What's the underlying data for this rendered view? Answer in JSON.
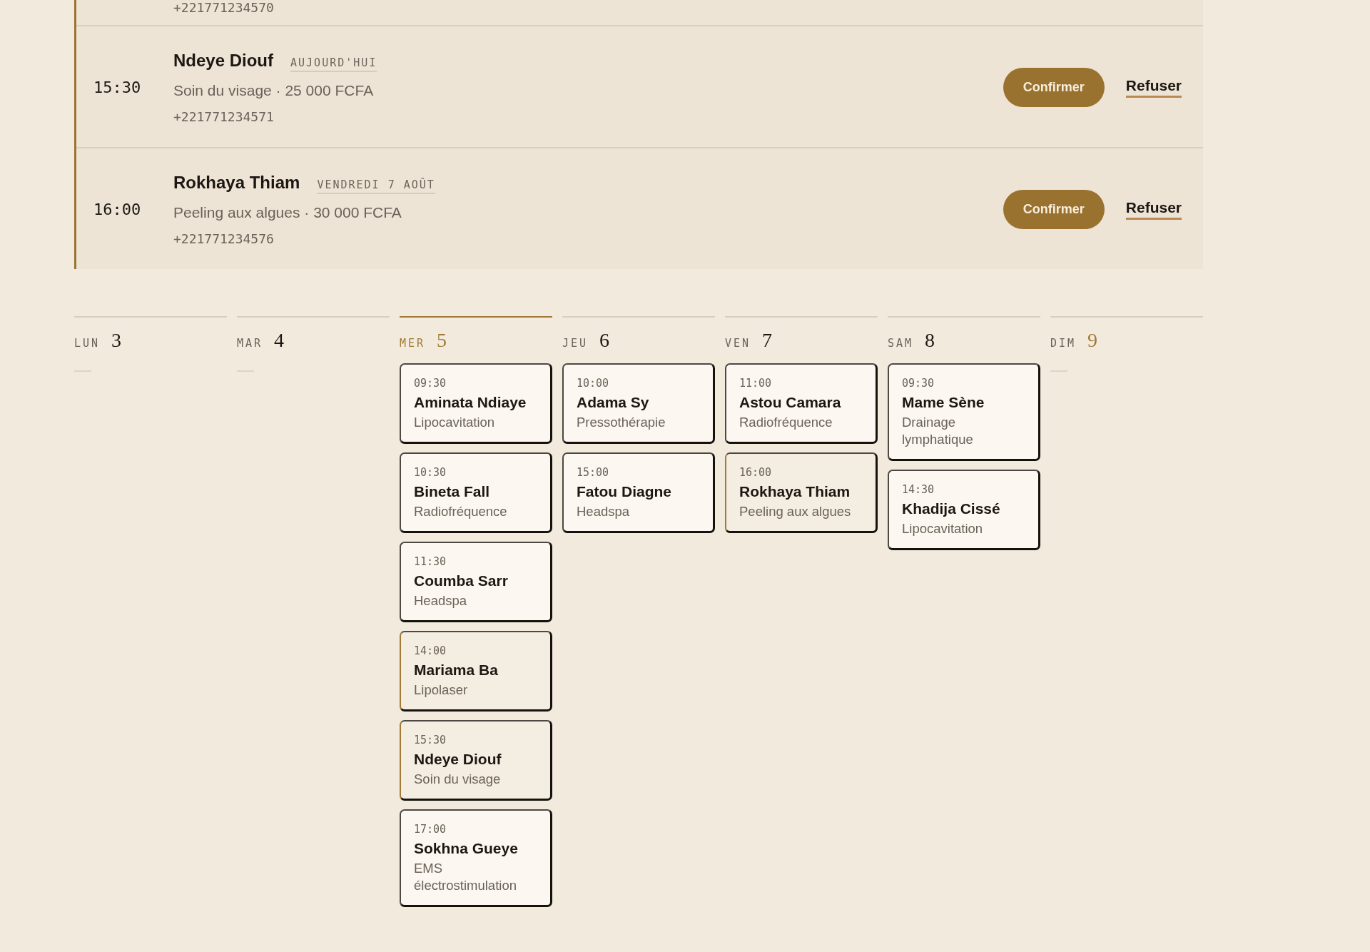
{
  "requests": [
    {
      "phone": "+221771234570"
    },
    {
      "time": "15:30",
      "name": "Ndeye Diouf",
      "day_badge": "AUJOURD'HUI",
      "service": "Soin du visage · 25 000 FCFA",
      "phone": "+221771234571",
      "confirm": "Confirmer",
      "refuse": "Refuser"
    },
    {
      "time": "16:00",
      "name": "Rokhaya Thiam",
      "day_badge": "VENDREDI 7 AOÛT",
      "service": "Peeling aux algues · 30 000 FCFA",
      "phone": "+221771234576",
      "confirm": "Confirmer",
      "refuse": "Refuser"
    }
  ],
  "days": [
    {
      "label": "LUN",
      "number": "3",
      "today": false,
      "number_accent": false
    },
    {
      "label": "MAR",
      "number": "4",
      "today": false,
      "number_accent": false
    },
    {
      "label": "MER",
      "number": "5",
      "today": true,
      "number_accent": true,
      "appointments": [
        {
          "time": "09:30",
          "name": "Aminata Ndiaye",
          "service": "Lipocavitation",
          "pending": false
        },
        {
          "time": "10:30",
          "name": "Bineta Fall",
          "service": "Radiofréquence",
          "pending": false
        },
        {
          "time": "11:30",
          "name": "Coumba Sarr",
          "service": "Headspa",
          "pending": false
        },
        {
          "time": "14:00",
          "name": "Mariama Ba",
          "service": "Lipolaser",
          "pending": true
        },
        {
          "time": "15:30",
          "name": "Ndeye Diouf",
          "service": "Soin du visage",
          "pending": true
        },
        {
          "time": "17:00",
          "name": "Sokhna Gueye",
          "service": "EMS électrostimulation",
          "pending": false
        }
      ]
    },
    {
      "label": "JEU",
      "number": "6",
      "today": false,
      "number_accent": false,
      "appointments": [
        {
          "time": "10:00",
          "name": "Adama Sy",
          "service": "Pressothérapie",
          "pending": false
        },
        {
          "time": "15:00",
          "name": "Fatou Diagne",
          "service": "Headspa",
          "pending": false
        }
      ]
    },
    {
      "label": "VEN",
      "number": "7",
      "today": false,
      "number_accent": false,
      "appointments": [
        {
          "time": "11:00",
          "name": "Astou Camara",
          "service": "Radiofréquence",
          "pending": false
        },
        {
          "time": "16:00",
          "name": "Rokhaya Thiam",
          "service": "Peeling aux algues",
          "pending": true
        }
      ]
    },
    {
      "label": "SAM",
      "number": "8",
      "today": false,
      "number_accent": false,
      "appointments": [
        {
          "time": "09:30",
          "name": "Mame Sène",
          "service": "Drainage lymphatique",
          "pending": false
        },
        {
          "time": "14:30",
          "name": "Khadija Cissé",
          "service": "Lipocavitation",
          "pending": false
        }
      ]
    },
    {
      "label": "DIM",
      "number": "9",
      "today": false,
      "number_accent": true
    }
  ]
}
